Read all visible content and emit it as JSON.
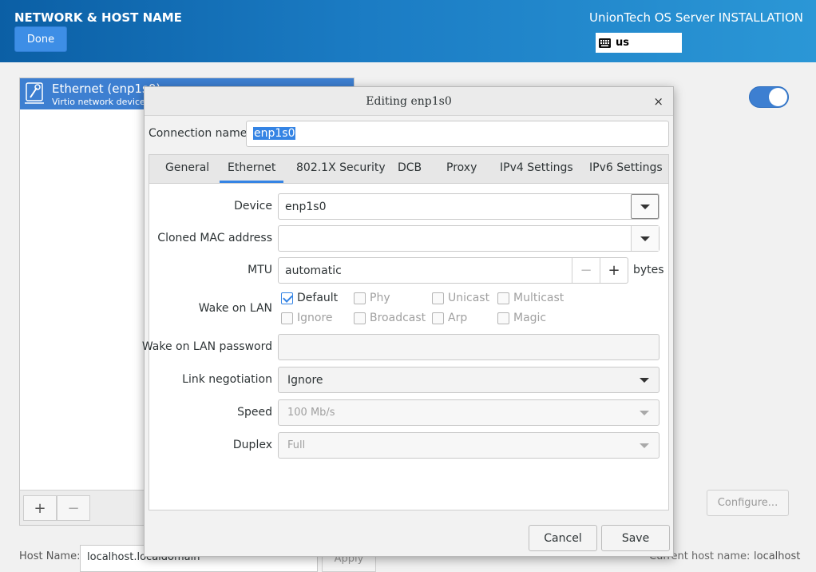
{
  "header": {
    "spoke_title": "NETWORK & HOST NAME",
    "done_label": "Done",
    "product_title": "UnionTech OS Server INSTALLATION",
    "keyboard_layout": "us"
  },
  "device_list": {
    "items": [
      {
        "name": "Ethernet (enp1s0)",
        "description": "Virtio network device",
        "selected": true
      }
    ],
    "add_label": "+",
    "remove_label": "−"
  },
  "toggle": {
    "on": true
  },
  "configure_label": "Configure...",
  "hostname": {
    "label": "Host Name:",
    "value": "localhost.localdomain",
    "apply_label": "Apply",
    "current_label": "Current host name:",
    "current_value": "localhost"
  },
  "dialog": {
    "title": "Editing enp1s0",
    "close_label": "×",
    "connection_name_label": "Connection name",
    "connection_name_value": "enp1s0",
    "tabs": [
      {
        "label": "General"
      },
      {
        "label": "Ethernet",
        "active": true
      },
      {
        "label": "802.1X Security"
      },
      {
        "label": "DCB"
      },
      {
        "label": "Proxy"
      },
      {
        "label": "IPv4 Settings"
      },
      {
        "label": "IPv6 Settings"
      }
    ],
    "ethernet": {
      "device_label": "Device",
      "device_value": "enp1s0",
      "cloned_mac_label": "Cloned MAC address",
      "cloned_mac_value": "",
      "mtu_label": "MTU",
      "mtu_value": "automatic",
      "mtu_minus": "−",
      "mtu_plus": "+",
      "mtu_unit": "bytes",
      "wol_label": "Wake on LAN",
      "wol_options": [
        {
          "label": "Default",
          "checked": true
        },
        {
          "label": "Phy",
          "checked": false
        },
        {
          "label": "Unicast",
          "checked": false
        },
        {
          "label": "Multicast",
          "checked": false
        },
        {
          "label": "Ignore",
          "checked": false
        },
        {
          "label": "Broadcast",
          "checked": false
        },
        {
          "label": "Arp",
          "checked": false
        },
        {
          "label": "Magic",
          "checked": false
        }
      ],
      "wol_password_label": "Wake on LAN password",
      "wol_password_value": "",
      "link_negotiation_label": "Link negotiation",
      "link_negotiation_value": "Ignore",
      "speed_label": "Speed",
      "speed_value": "100 Mb/s",
      "duplex_label": "Duplex",
      "duplex_value": "Full"
    },
    "cancel_label": "Cancel",
    "save_label": "Save"
  }
}
